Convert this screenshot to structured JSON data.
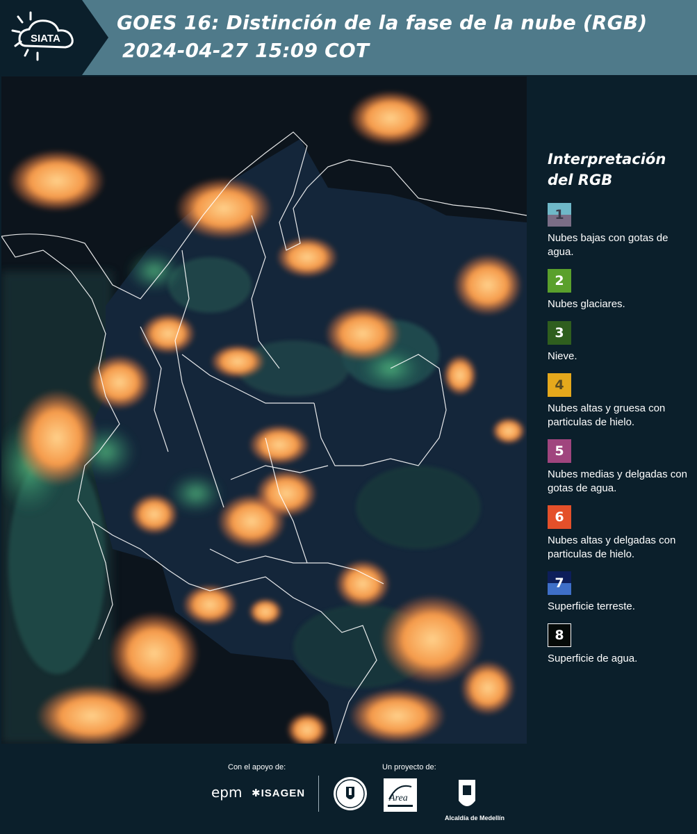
{
  "header": {
    "logo_text": "SIATA",
    "title_line1": "GOES 16: Distinción de la fase de la nube (RGB)",
    "title_line2": "2024-04-27 15:09 COT"
  },
  "legend": {
    "title_line1": "Interpretación",
    "title_line2": "del RGB",
    "items": [
      {
        "number": "1",
        "label": "Nubes bajas con gotas de agua.",
        "color_top": "#6fb8c8",
        "color_bottom": "#7a6d86"
      },
      {
        "number": "2",
        "label": "Nubes glaciares.",
        "color": "#5aa02c"
      },
      {
        "number": "3",
        "label": "Nieve.",
        "color": "#2f5e1e"
      },
      {
        "number": "4",
        "label": "Nubes altas y gruesa con particulas de hielo.",
        "color": "#e5a81c"
      },
      {
        "number": "5",
        "label": "Nubes medias y delgadas con gotas de agua.",
        "color": "#a0457e"
      },
      {
        "number": "6",
        "label": "Nubes altas y delgadas con particulas de hielo.",
        "color": "#e4502a"
      },
      {
        "number": "7",
        "label": "Superficie terreste.",
        "color_top": "#0d1e5a",
        "color_bottom": "#3e6fc8"
      },
      {
        "number": "8",
        "label": "Superficie de agua.",
        "color": "#050a08"
      }
    ]
  },
  "footer": {
    "support_label": "Con el apoyo de:",
    "project_label": "Un proyecto de:",
    "sponsor_1": "epm",
    "sponsor_2": "ISAGEN",
    "project_org": "Alcaldía de Medellín",
    "area_logo_text": "Área"
  },
  "colors": {
    "header_band": "#4f7a8a",
    "background": "#0b1f2b",
    "cloud_orange": "#f59a4a",
    "cloud_green": "#4fbf6a",
    "land": "#13253a"
  }
}
